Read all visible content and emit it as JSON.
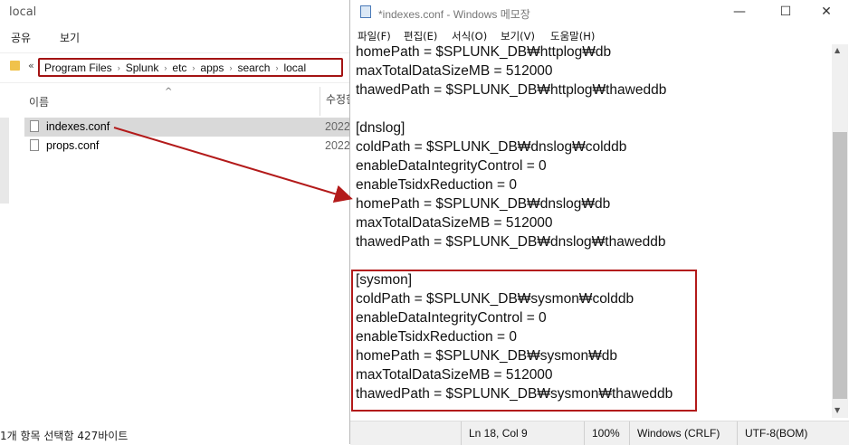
{
  "explorer": {
    "title": "local",
    "ribbon": [
      "공유",
      "보기"
    ],
    "address_prefix": "«",
    "breadcrumb": [
      "Program Files",
      "Splunk",
      "etc",
      "apps",
      "search",
      "local"
    ],
    "columns": {
      "name": "이름",
      "modified": "수정한"
    },
    "sort_caret": "^",
    "files": [
      {
        "name": "indexes.conf",
        "date": "2022",
        "selected": true
      },
      {
        "name": "props.conf",
        "date": "2022",
        "selected": false
      }
    ],
    "status": "1개 항목 선택함 427바이트"
  },
  "notepad": {
    "title": "*indexes.conf - Windows 메모장",
    "window_controls": {
      "minimize": "—",
      "maximize": "☐",
      "close": "✕"
    },
    "menu": [
      "파일(F)",
      "편집(E)",
      "서식(O)",
      "보기(V)",
      "도움말(H)"
    ],
    "lines": [
      "homePath = $SPLUNK_DB₩httplog₩db",
      "maxTotalDataSizeMB = 512000",
      "thawedPath = $SPLUNK_DB₩httplog₩thaweddb",
      "",
      "[dnslog]",
      "coldPath = $SPLUNK_DB₩dnslog₩colddb",
      "enableDataIntegrityControl = 0",
      "enableTsidxReduction = 0",
      "homePath = $SPLUNK_DB₩dnslog₩db",
      "maxTotalDataSizeMB = 512000",
      "thawedPath = $SPLUNK_DB₩dnslog₩thaweddb",
      "",
      "[sysmon]",
      "coldPath = $SPLUNK_DB₩sysmon₩colddb",
      "enableDataIntegrityControl = 0",
      "enableTsidxReduction = 0",
      "homePath = $SPLUNK_DB₩sysmon₩db",
      "maxTotalDataSizeMB = 512000",
      "thawedPath = $SPLUNK_DB₩sysmon₩thaweddb"
    ],
    "status": {
      "position": "Ln 18, Col 9",
      "zoom": "100%",
      "line_ending": "Windows (CRLF)",
      "encoding": "UTF-8(BOM)"
    }
  },
  "colors": {
    "annotation_red": "#b31a1a",
    "selection": "#d9d9d9"
  }
}
